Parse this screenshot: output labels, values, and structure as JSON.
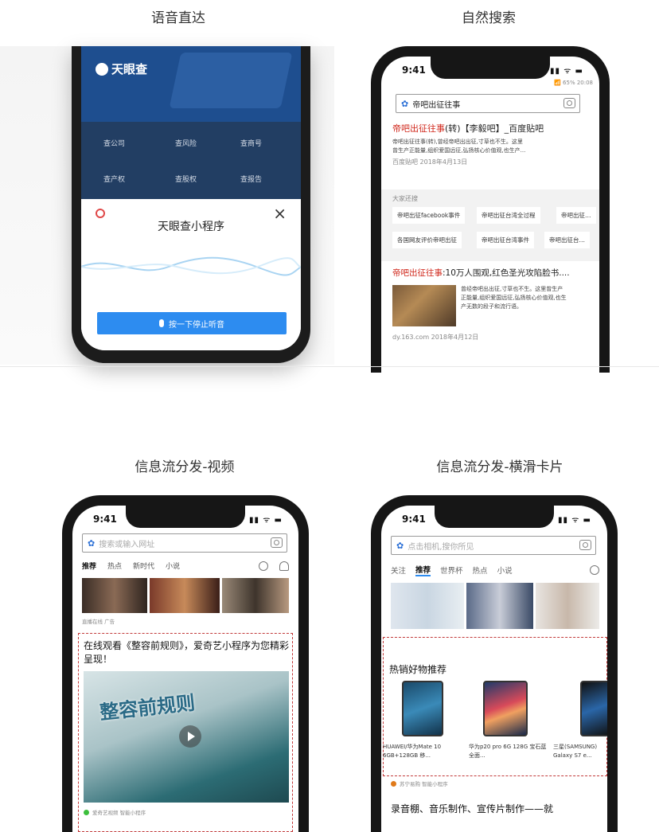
{
  "captions": {
    "voice": "语音直达",
    "search": "自然搜索",
    "video": "信息流分发-视频",
    "card": "信息流分发-横滑卡片"
  },
  "voice": {
    "brand": "天眼查",
    "grid": [
      "查公司",
      "查风险",
      "查商号",
      "查产权",
      "查股权",
      "查报告"
    ],
    "popup_title": "天眼查小程序",
    "close": "×",
    "button": "按一下停止听音"
  },
  "search": {
    "time": "9:41",
    "status_right": "📶 65% 20:08",
    "query": "帝吧出征往事",
    "r1_title_hl": "帝吧出征往事",
    "r1_title_rest": "(转)【李毅吧】_百度贴吧",
    "r1_line1": "帝吧出征往事(转),曾经帝吧出出征,寸草也不生。这里",
    "r1_line2": "曾生产正能量,组织爱国远征,弘扬核心价值观,也生产...",
    "r1_meta": "百度贴吧  2018年4月13日",
    "also_search": "大家还搜",
    "chips": [
      "帝吧出征facebook事件",
      "帝吧出征台湾全过程",
      "帝吧出征…",
      "各国网友评价帝吧出征",
      "帝吧出征台湾事件",
      "帝吧出征台…"
    ],
    "r2_title_hl": "帝吧出征往事",
    "r2_title_rest": ":10万人围观,红色圣光攻陷脸书....",
    "r2_line1": "曾经帝吧出出征,寸草也不生。这里曾生产",
    "r2_line2": "正能量,组织爱国远征,弘扬核心价值观,也生",
    "r2_line3": "产无数的段子和流行语。",
    "r2_meta": "dy.163.com  2018年4月12日"
  },
  "video": {
    "time": "9:41",
    "search_placeholder": "搜索或输入网址",
    "tabs": [
      "推荐",
      "热点",
      "新时代",
      "小说"
    ],
    "ad_label": "直播在线 广告",
    "headline": "在线观看《整容前规则》，爱奇艺小程序为您精彩呈现！",
    "poster_text": "整容前规则",
    "source": "爱奇艺视频  智能小程序"
  },
  "card": {
    "time": "9:41",
    "search_placeholder": "点击相机,搜你所见",
    "tabs": [
      "关注",
      "推荐",
      "世界杯",
      "热点",
      "小说"
    ],
    "section": "热销好物推荐",
    "products": [
      "HUAWEI/华为Mate 10 6GB+128GB 移...",
      "华为p20 pro 6G 128G 宝石蓝 全面...",
      "三星(SAMSUNG) Galaxy S7 e..."
    ],
    "source": "苏宁易购  智能小程序",
    "headline": "录音棚、音乐制作、宣传片制作——就"
  },
  "colors": {
    "accent_blue": "#2d8cf0",
    "brand_red": "#d0281c",
    "dash_red": "#c23a3a"
  }
}
